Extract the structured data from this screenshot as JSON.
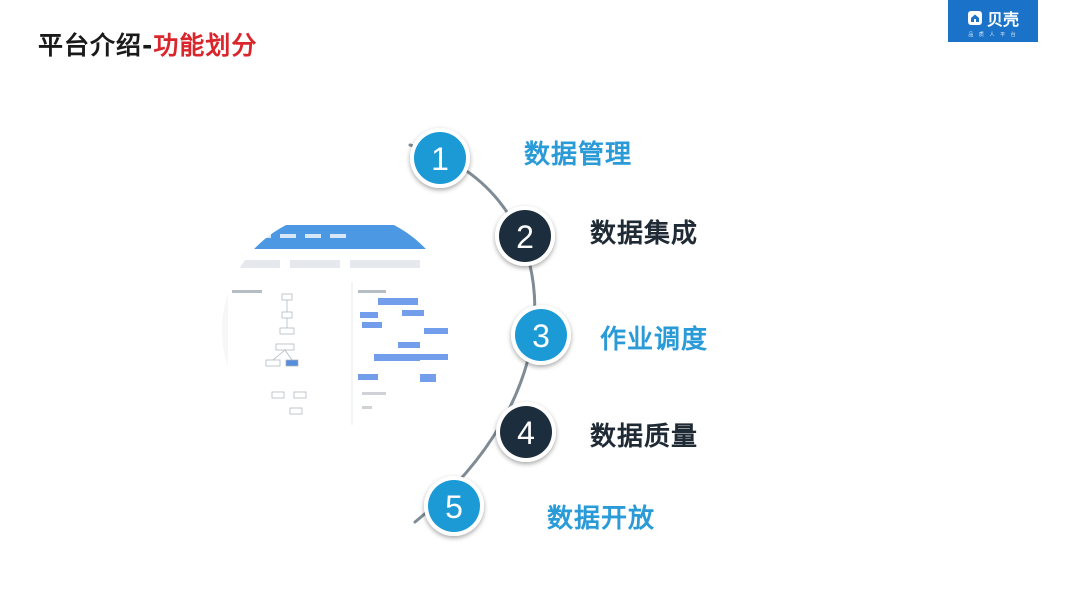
{
  "header": {
    "title_prefix": "平台介绍-",
    "title_accent": "功能划分"
  },
  "logo": {
    "text": "贝壳",
    "subtext": "品 质 人 平 台"
  },
  "steps": [
    {
      "number": "1",
      "label": "数据管理",
      "style": "light"
    },
    {
      "number": "2",
      "label": "数据集成",
      "style": "dark"
    },
    {
      "number": "3",
      "label": "作业调度",
      "style": "light"
    },
    {
      "number": "4",
      "label": "数据质量",
      "style": "dark"
    },
    {
      "number": "5",
      "label": "数据开放",
      "style": "light"
    }
  ],
  "colors": {
    "light_circle": "#1b9ad6",
    "dark_circle": "#1f2f3d",
    "arc": "#7f8c95",
    "accent": "#d9262c",
    "logo_bg": "#1a73c8"
  },
  "icons": [
    "house-logo-icon"
  ]
}
